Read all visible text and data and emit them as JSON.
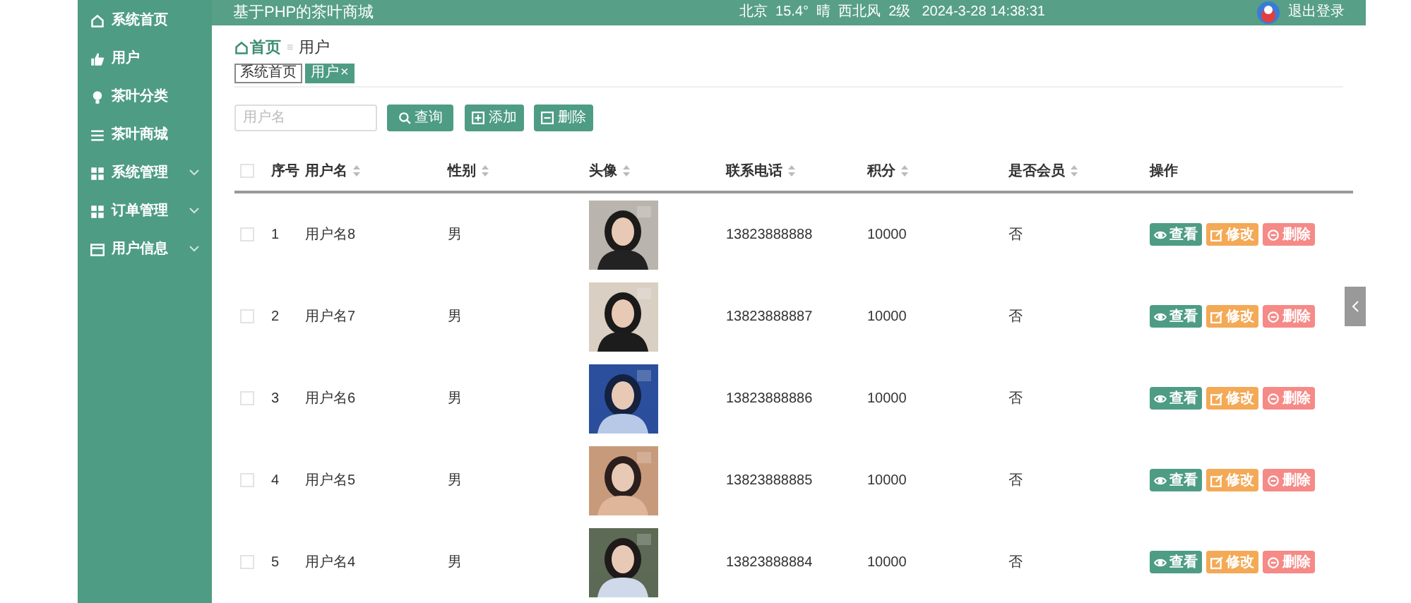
{
  "sidebar": {
    "items": [
      {
        "label": "系统首页",
        "expandable": false
      },
      {
        "label": "用户",
        "expandable": false
      },
      {
        "label": "茶叶分类",
        "expandable": false
      },
      {
        "label": "茶叶商城",
        "expandable": false
      },
      {
        "label": "系统管理",
        "expandable": true
      },
      {
        "label": "订单管理",
        "expandable": true
      },
      {
        "label": "用户信息",
        "expandable": true
      }
    ]
  },
  "header": {
    "title": "基于PHP的茶叶商城",
    "weather": "北京  15.4°  晴  西北风  2级",
    "datetime": "2024-3-28 14:38:31",
    "logout": "退出登录"
  },
  "breadcrumb": {
    "home": "首页",
    "separator": "≡",
    "current": "用户"
  },
  "tabs": [
    {
      "label": "系统首页",
      "selected": false
    },
    {
      "label": "用户",
      "selected": true,
      "close": "×"
    }
  ],
  "search": {
    "placeholder": "用户名",
    "buttons": [
      {
        "label": "查询",
        "kind": "search"
      },
      {
        "label": "添加",
        "kind": "add"
      },
      {
        "label": "删除",
        "kind": "delete"
      }
    ]
  },
  "table": {
    "select_all_checked": false,
    "columns": [
      {
        "label": "序号",
        "sortable": false
      },
      {
        "label": "用户名",
        "sortable": true
      },
      {
        "label": "性别",
        "sortable": true
      },
      {
        "label": "头像",
        "sortable": true
      },
      {
        "label": "联系电话",
        "sortable": true
      },
      {
        "label": "积分",
        "sortable": true
      },
      {
        "label": "是否会员",
        "sortable": true
      },
      {
        "label": "操作",
        "sortable": false
      }
    ],
    "rows": [
      {
        "checked": false,
        "index": "1",
        "username": "用户名8",
        "gender": "男",
        "phone": "13823888888",
        "points": "10000",
        "member": "否",
        "actions": [
          {
            "label": "查看",
            "kind": "view"
          },
          {
            "label": "修改",
            "kind": "edit"
          },
          {
            "label": "删除",
            "kind": "delete"
          }
        ]
      },
      {
        "checked": false,
        "index": "2",
        "username": "用户名7",
        "gender": "男",
        "phone": "13823888887",
        "points": "10000",
        "member": "否",
        "actions": [
          {
            "label": "查看",
            "kind": "view"
          },
          {
            "label": "修改",
            "kind": "edit"
          },
          {
            "label": "删除",
            "kind": "delete"
          }
        ]
      },
      {
        "checked": false,
        "index": "3",
        "username": "用户名6",
        "gender": "男",
        "phone": "13823888886",
        "points": "10000",
        "member": "否",
        "actions": [
          {
            "label": "查看",
            "kind": "view"
          },
          {
            "label": "修改",
            "kind": "edit"
          },
          {
            "label": "删除",
            "kind": "delete"
          }
        ]
      },
      {
        "checked": false,
        "index": "4",
        "username": "用户名5",
        "gender": "男",
        "phone": "13823888885",
        "points": "10000",
        "member": "否",
        "actions": [
          {
            "label": "查看",
            "kind": "view"
          },
          {
            "label": "修改",
            "kind": "edit"
          },
          {
            "label": "删除",
            "kind": "delete"
          }
        ]
      },
      {
        "checked": false,
        "index": "5",
        "username": "用户名4",
        "gender": "男",
        "phone": "13823888884",
        "points": "10000",
        "member": "否",
        "actions": [
          {
            "label": "查看",
            "kind": "view"
          },
          {
            "label": "修改",
            "kind": "edit"
          },
          {
            "label": "删除",
            "kind": "delete"
          }
        ]
      }
    ]
  }
}
